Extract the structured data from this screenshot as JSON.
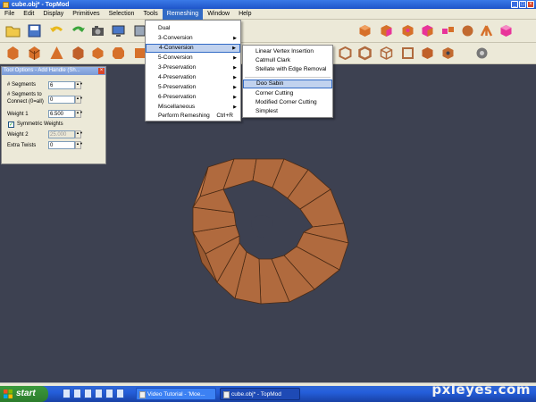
{
  "window": {
    "title": "cube.obj* - TopMod",
    "minimize": "_",
    "maximize": "□",
    "close": "×"
  },
  "menubar": [
    "File",
    "Edit",
    "Display",
    "Primitives",
    "Selection",
    "Tools",
    "Remeshing",
    "Window",
    "Help"
  ],
  "tool_options": {
    "title": "Tool Options - Add Handle (Sh...",
    "close": "×",
    "segments_label": "# Segments",
    "segments_value": "6",
    "connect_label_1": "# Segments to",
    "connect_label_2": "Connect (0=all)",
    "connect_value": "0",
    "weight1_label": "Weight 1",
    "weight1_value": "6.500",
    "symmetric_label": "Symmetric Weights",
    "symmetric_checked": true,
    "weight2_label": "Weight 2",
    "weight2_value": "25.000",
    "twists_label": "Extra Twists",
    "twists_value": "0"
  },
  "remeshing_menu": {
    "items": [
      {
        "label": "Dual",
        "submenu": false
      },
      {
        "label": "3-Conversion",
        "submenu": true
      },
      {
        "label": "4-Conversion",
        "submenu": true
      },
      {
        "label": "5-Conversion",
        "submenu": true
      },
      {
        "label": "3-Preservation",
        "submenu": true
      },
      {
        "label": "4-Preservation",
        "submenu": true
      },
      {
        "label": "5-Preservation",
        "submenu": true
      },
      {
        "label": "6-Preservation",
        "submenu": true
      },
      {
        "label": "Miscellaneous",
        "submenu": true
      },
      {
        "label": "Perform Remeshing",
        "shortcut": "Ctrl+R"
      }
    ],
    "highlighted": "4-Conversion"
  },
  "conversion_submenu": {
    "items": [
      "Linear Vertex Insertion",
      "Catmull Clark",
      "Stellate with Edge Removal",
      "Doo Sabin",
      "Corner Cutting",
      "Modified Corner Cutting",
      "Simplest"
    ],
    "highlighted": "Doo Sabin"
  },
  "taskbar": {
    "start_label": "start",
    "tasks": [
      {
        "label": "Video Tutorial - 'Moe...",
        "active": false
      },
      {
        "label": "cube.obj* - TopMod",
        "active": true
      }
    ]
  },
  "watermark": "pxleyes.com",
  "colors": {
    "mesh": "#b06a3e",
    "mesh_edge": "#4a2a14",
    "viewport_bg": "#3d4151",
    "menu_highlight": "#316ac5"
  }
}
